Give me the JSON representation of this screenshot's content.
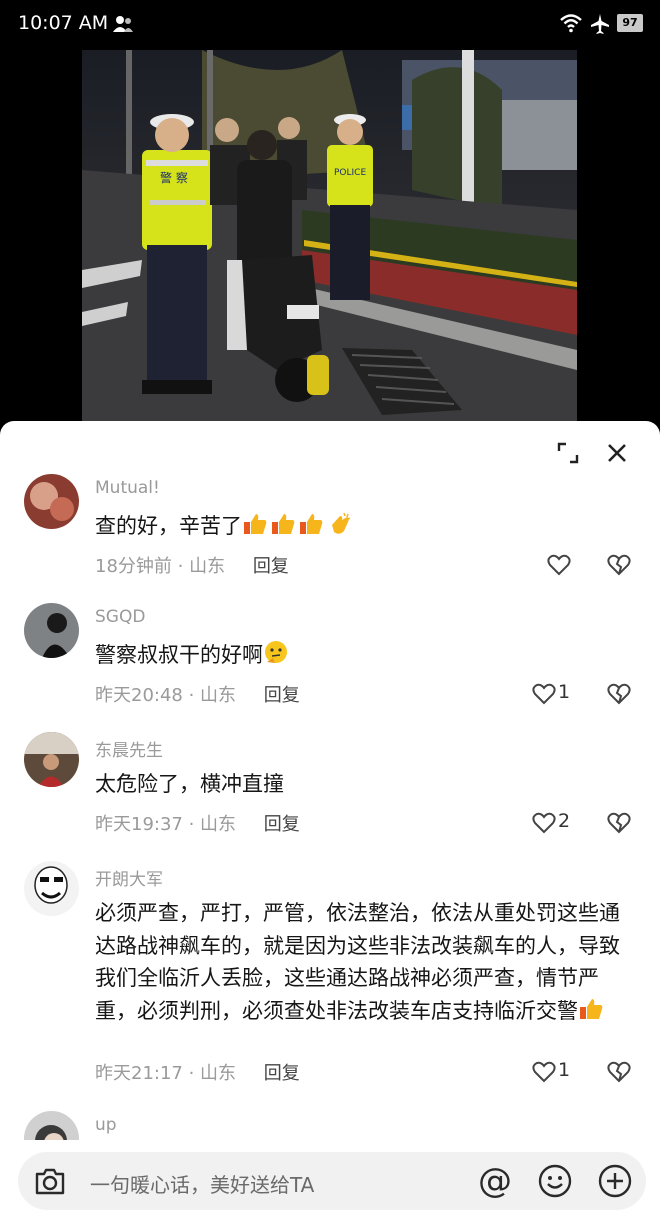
{
  "status_bar": {
    "time": "10:07 AM",
    "battery": "97"
  },
  "comments": [
    {
      "username": "Mutual!",
      "text": "查的好，辛苦了",
      "time": "18分钟前",
      "location": "山东",
      "reply": "回复",
      "likes": ""
    },
    {
      "username": "SGQD",
      "text": "警察叔叔干的好啊",
      "time": "昨天20:48",
      "location": "山东",
      "reply": "回复",
      "likes": "1"
    },
    {
      "username": "东晨先生",
      "text": "太危险了，横冲直撞",
      "time": "昨天19:37",
      "location": "山东",
      "reply": "回复",
      "likes": "2"
    },
    {
      "username": "开朗大军",
      "text": "必须严查，严打，严管，依法整治，依法从重处罚这些通达路战神飙车的，就是因为这些非法改装飙车的人，导致我们全临沂人丢脸，这些通达路战神必须严查，情节严重，必须判刑，必须查处非法改装车店支持临沂交警",
      "time": "昨天21:17",
      "location": "山东",
      "reply": "回复",
      "likes": "1"
    },
    {
      "username": "up"
    }
  ],
  "meta_separator": " · ",
  "input": {
    "placeholder": "一句暖心话，美好送给TA"
  }
}
